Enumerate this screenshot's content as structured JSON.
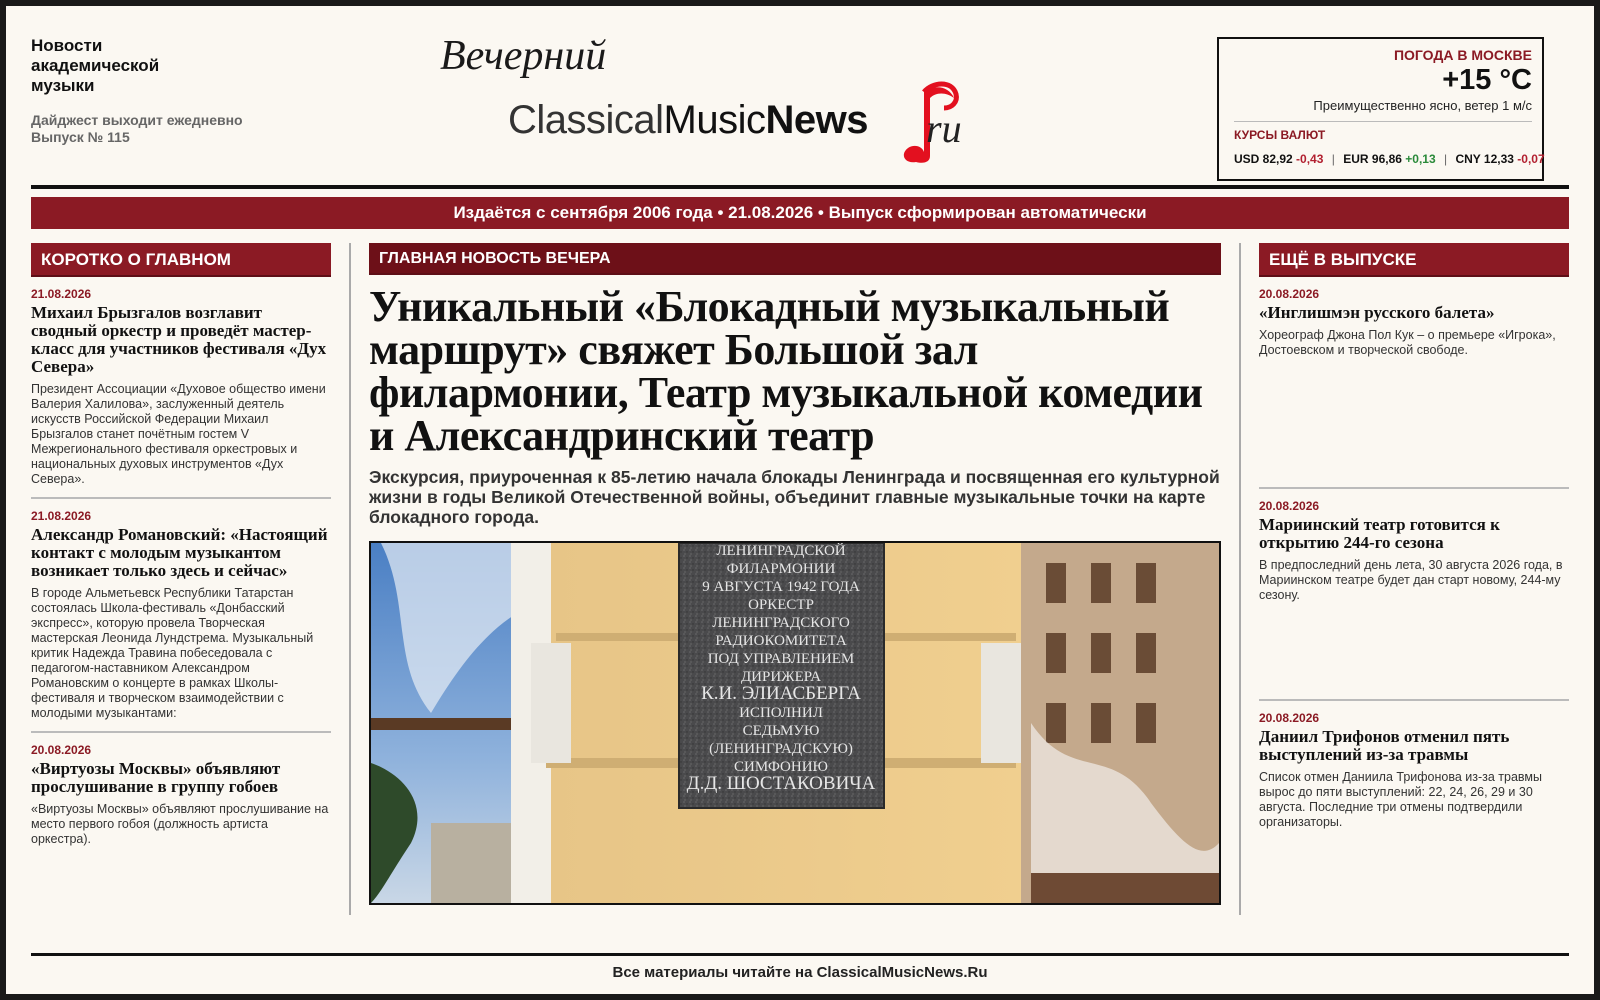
{
  "header": {
    "site_name": "Новости академической музыки",
    "digest_line1": "Дайджест выходит ежедневно",
    "digest_line2": "Выпуск № 115"
  },
  "logo": {
    "evening": "Вечерний",
    "word_classical": "Classical",
    "word_music": "Music",
    "word_news": "News",
    "word_ru": "ru"
  },
  "weather": {
    "title": "ПОГОДА В МОСКВЕ",
    "temp": "+15 °C",
    "desc": "Преимущественно ясно, ветер 1 м/с"
  },
  "fx": {
    "title": "КУРСЫ ВАЛЮТ",
    "usd_label": "USD 82,92",
    "usd_change": "-0,43",
    "eur_label": "EUR 96,86",
    "eur_change": "+0,13",
    "cny_label": "CNY 12,33",
    "cny_change": "-0,07",
    "separator": "|"
  },
  "banner": "Издаётся с сентября 2006 года • 21.08.2026 • Выпуск сформирован автоматически",
  "left": {
    "heading": "КОРОТКО О ГЛАВНОМ",
    "items": [
      {
        "date": "21.08.2026",
        "title": "Михаил Брызгалов возглавит сводный оркестр и проведёт мастер-класс для участников фестиваля «Дух Севера»",
        "text": "Президент Ассоциации «Духовое общество имени Валерия Халилова», заслуженный деятель искусств Российской Федерации Михаил Брызгалов станет почётным гостем V Межрегионального фестиваля оркестровых и национальных духовых инструментов «Дух Севера»."
      },
      {
        "date": "21.08.2026",
        "title": "Александр Романовский: «Настоящий контакт с молодым музыкантом возникает только здесь и сейчас»",
        "text": "В городе Альметьевск Республики Татарстан состоялась Школа-фестиваль «Донбасский экспресс», которую провела Творческая мастерская Леонида Лундстрема. Музыкальный критик Надежда Травина побеседовала с педагогом-наставником Александром Романовским о концерте в рамках Школы-фестиваля и творческом взаимодействии с молодыми музыкантами:"
      },
      {
        "date": "20.08.2026",
        "title": "«Виртуозы Москвы» объявляют прослушивание в группу гобоев",
        "text": "«Виртуозы Москвы» объявляют прослушивание на место первого гобоя (должность артиста оркестра)."
      }
    ]
  },
  "main": {
    "heading": "ГЛАВНАЯ НОВОСТЬ ВЕЧЕРА",
    "title": "Уникальный «Блокадный музыкальный маршрут» свяжет Большой зал филармонии, Театр музыкальной комедии и Александринский театр",
    "lead": "Экскурсия, приуроченная к 85-летию начала блокады Ленинграда и посвященная его культурной жизни в годы Великой Отечественной войны, объединит главные музыкальные точки на карте блокадного города.",
    "plaque_lines": [
      "ЛЕНИНГРАДСКОЙ",
      "ФИЛАРМОНИИ",
      "9 АВГУСТА 1942 ГОДА",
      "ОРКЕСТР",
      "ЛЕНИНГРАДСКОГО",
      "РАДИОКОМИТЕТА",
      "ПОД УПРАВЛЕНИЕМ",
      "ДИРИЖЕРА",
      "К.И. ЭЛИАСБЕРГА",
      "ИСПОЛНИЛ",
      "СЕДЬМУЮ",
      "(ЛЕНИНГРАДСКУЮ)",
      "СИМФОНИЮ",
      "Д.Д. ШОСТАКОВИЧА"
    ]
  },
  "right": {
    "heading": "ЕЩЁ В ВЫПУСКЕ",
    "items": [
      {
        "date": "20.08.2026",
        "title": "«Инглишмэн русского балета»",
        "text": "Хореограф Джона Пол Кук – о премьере «Игрока», Достоевском и творческой свободе."
      },
      {
        "date": "20.08.2026",
        "title": "Мариинский театр готовится к открытию 244-го сезона",
        "text": "В предпоследний день лета, 30 августа 2026 года, в Мариинском театре будет дан старт новому, 244-му сезону."
      },
      {
        "date": "20.08.2026",
        "title": "Даниил Трифонов отменил пять выступлений из-за травмы",
        "text": "Список отмен Даниила Трифонова из-за травмы вырос до пяти выступлений: 22, 24, 26, 29 и 30 августа. Последние три отмены подтвердили организаторы."
      }
    ]
  },
  "footer": "Все материалы читайте на ClassicalMusicNews.Ru",
  "colors": {
    "accent": "#8b1a24",
    "accent_dark": "#6d1018",
    "paper": "#fbf8f2",
    "up": "#2a8a3a",
    "down": "#b22030"
  }
}
